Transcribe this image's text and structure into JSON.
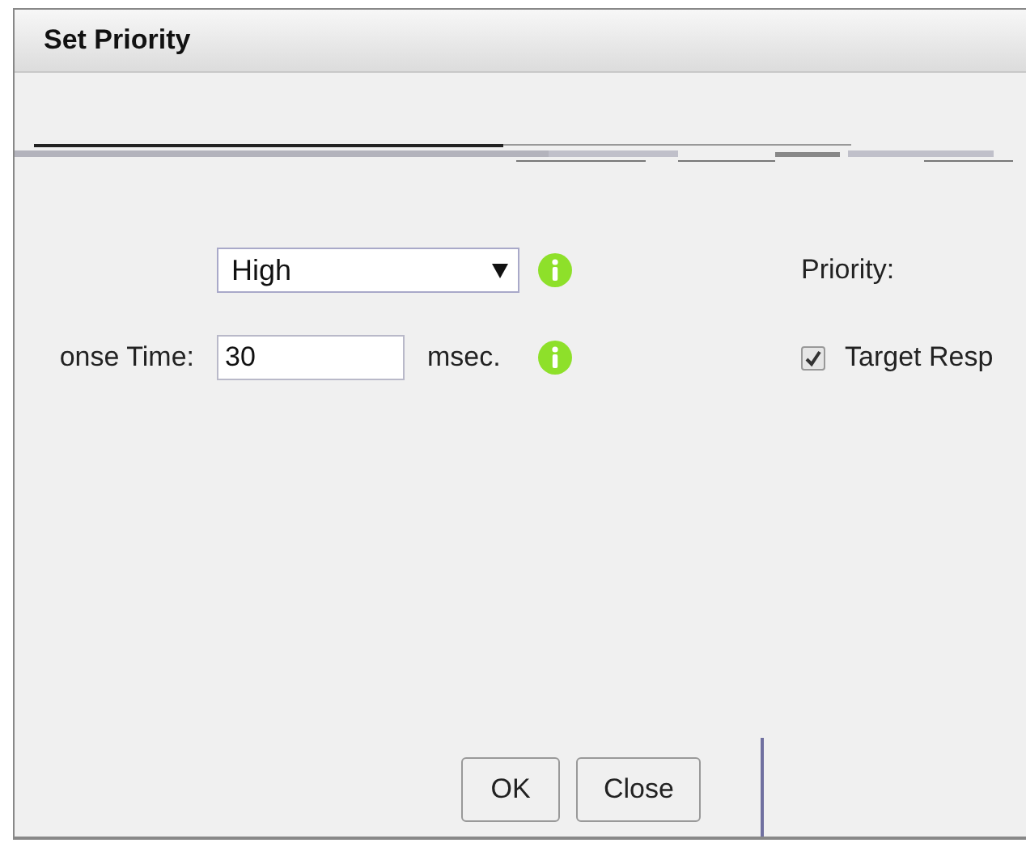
{
  "dialog": {
    "title": "Set Priority"
  },
  "rows": [
    {
      "kind": "select",
      "value": "High",
      "info": true,
      "side": {
        "kind": "label",
        "text": "Priority:"
      }
    },
    {
      "kind": "text",
      "label": "onse Time:",
      "value": "30",
      "unit": "msec.",
      "info": true,
      "side": {
        "kind": "checkbox",
        "text": "Target Resp",
        "checked": true
      }
    }
  ],
  "buttons": [
    {
      "label": "OK"
    },
    {
      "label": "Close"
    }
  ]
}
